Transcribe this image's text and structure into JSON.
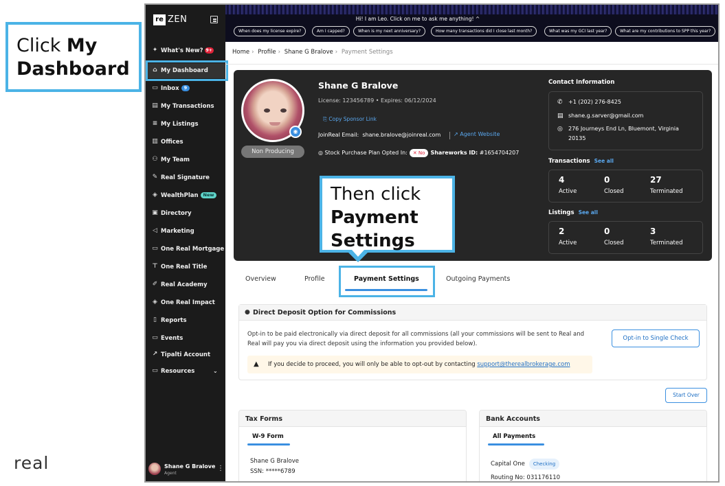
{
  "callout1": {
    "line1": "Click ",
    "bold": "My Dashboard"
  },
  "callout2": {
    "line1": "Then click",
    "bold": "Payment Settings"
  },
  "brand": {
    "logo_re": "re",
    "logo_zen": "ZEN",
    "footer_logo": "real"
  },
  "sidebar": {
    "whats_new": "What's New?",
    "whats_new_badge": "9+",
    "items": [
      {
        "label": "My Dashboard",
        "icon": "home-icon"
      },
      {
        "label": "Inbox",
        "icon": "inbox-icon",
        "badge": "9"
      },
      {
        "label": "My Transactions",
        "icon": "clipboard-icon"
      },
      {
        "label": "My Listings",
        "icon": "list-icon"
      },
      {
        "label": "Offices",
        "icon": "building-icon"
      },
      {
        "label": "My Team",
        "icon": "team-icon"
      },
      {
        "label": "Real Signature",
        "icon": "signature-icon"
      },
      {
        "label": "WealthPlan",
        "icon": "wealth-icon",
        "badge": "New"
      },
      {
        "label": "Directory",
        "icon": "directory-icon"
      },
      {
        "label": "Marketing",
        "icon": "megaphone-icon"
      },
      {
        "label": "One Real Mortgage",
        "icon": "mortgage-icon"
      },
      {
        "label": "One Real Title",
        "icon": "title-icon"
      },
      {
        "label": "Real Academy",
        "icon": "academy-icon"
      },
      {
        "label": "One Real Impact",
        "icon": "impact-icon"
      },
      {
        "label": "Reports",
        "icon": "report-icon"
      },
      {
        "label": "Events",
        "icon": "calendar-icon"
      },
      {
        "label": "Tipalti Account",
        "icon": "external-link-icon"
      },
      {
        "label": "Resources",
        "icon": "folder-icon"
      }
    ],
    "user_name": "Shane G Bralove",
    "user_role": "Agent"
  },
  "topbar": {
    "leo": "Hi! I am Leo. Click on me to ask me anything!",
    "chips": [
      "When does my license expire?",
      "Am I capped?",
      "When is my next anniversary?",
      "How many transactions did I close last month?",
      "What was my GCI last year?",
      "What are my contributions to SPP this year?"
    ]
  },
  "breadcrumb": [
    "Home",
    "Profile",
    "Shane G Bralove",
    "Payment Settings"
  ],
  "profile": {
    "name": "Shane G Bralove",
    "license": "License: 123456789  •  Expires: 06/12/2024",
    "copy_sponsor": "Copy Sponsor Link",
    "email_label": "JoinReal Email:",
    "email": "shane.bralove@joinreal.com",
    "agent_website": "Agent Website",
    "spp_label": "Stock Purchase Plan Opted In:",
    "spp_value": "No",
    "shareworks": "Shareworks ID:",
    "shareworks_id": "#1654704207",
    "status": "Non Producing"
  },
  "contact": {
    "title": "Contact Information",
    "phone": "+1 (202) 276-8425",
    "email": "shane.g.sarver@gmail.com",
    "address1": "276 Journeys End Ln, Bluemont, Virginia",
    "address2": "20135"
  },
  "transactions": {
    "title": "Transactions",
    "see_all": "See all",
    "active": "4",
    "closed": "0",
    "terminated": "27"
  },
  "listings": {
    "title": "Listings",
    "see_all": "See all",
    "active": "2",
    "closed": "0",
    "terminated": "3"
  },
  "stat_labels": {
    "active": "Active",
    "closed": "Closed",
    "terminated": "Terminated"
  },
  "tabs": [
    "Overview",
    "Profile",
    "Payment Settings",
    "Outgoing Payments"
  ],
  "direct_deposit": {
    "title": "Direct Deposit Option for Commissions",
    "text": "Opt-in to be paid electronically via direct deposit for all commissions (all your commissions will be sent to Real and Real will pay you via direct deposit using the information you provided below).",
    "button": "Opt-in to Single Check",
    "warning": "If you decide to proceed, you will only be able to opt-out by contacting ",
    "warning_link": "support@therealbrokerage.com"
  },
  "start_over": "Start Over",
  "tax_forms": {
    "title": "Tax Forms",
    "tab": "W-9 Form",
    "name": "Shane G Bralove",
    "ssn": "SSN: *****6789"
  },
  "bank_accounts": {
    "title": "Bank Accounts",
    "tab": "All Payments",
    "bank": "Capital One",
    "type": "Checking",
    "routing": "Routing No: 031176110"
  },
  "colors": {
    "accent": "#4bb3e6",
    "link": "#3a8fe0",
    "sidebar": "#1b1b1b",
    "card": "#262626"
  }
}
